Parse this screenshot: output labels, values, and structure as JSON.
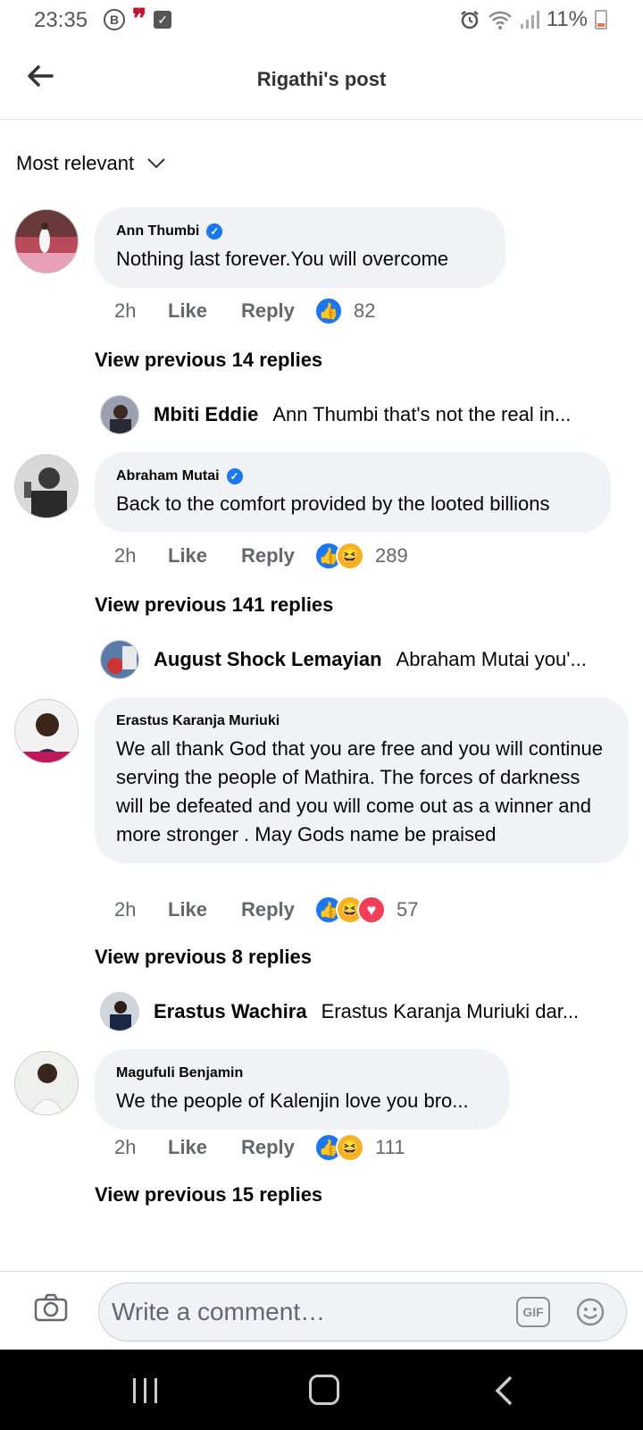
{
  "status_bar": {
    "time": "23:35",
    "battery": "11%",
    "icon_b": "B",
    "icon_quote": "❞"
  },
  "header": {
    "title": "Rigathi's post"
  },
  "sort": {
    "label": "Most relevant"
  },
  "comments": [
    {
      "author": "Ann Thumbi",
      "verified": true,
      "text": "Nothing last forever.You will overcome",
      "time": "2h",
      "like_label": "Like",
      "reply_label": "Reply",
      "reactions": [
        "like"
      ],
      "reaction_count": "82",
      "view_previous": "View previous 14 replies",
      "latest_reply": {
        "author": "Mbiti Eddie",
        "text": "Ann Thumbi that's not the real in..."
      }
    },
    {
      "author": "Abraham Mutai",
      "verified": true,
      "text": "Back to the comfort provided by the looted billions",
      "time": "2h",
      "like_label": "Like",
      "reply_label": "Reply",
      "reactions": [
        "like",
        "haha"
      ],
      "reaction_count": "289",
      "view_previous": "View previous 141 replies",
      "latest_reply": {
        "author": "August Shock Lemayian",
        "text": "Abraham Mutai you'..."
      }
    },
    {
      "author": "Erastus Karanja Muriuki",
      "verified": false,
      "text": "We all thank God that you are free and you will continue serving the people of Mathira. The forces of darkness will be defeated and you will come out as a winner and more stronger . May Gods name be praised",
      "time": "2h",
      "like_label": "Like",
      "reply_label": "Reply",
      "reactions": [
        "like",
        "haha",
        "love"
      ],
      "reaction_count": "57",
      "view_previous": "View previous 8 replies",
      "latest_reply": {
        "author": "Erastus Wachira",
        "text": "Erastus Karanja Muriuki dar..."
      }
    },
    {
      "author": "Magufuli Benjamin",
      "verified": false,
      "text": "We the people of Kalenjin love you bro...",
      "time": "2h",
      "like_label": "Like",
      "reply_label": "Reply",
      "reactions": [
        "like",
        "haha"
      ],
      "reaction_count": "111",
      "view_previous": "View previous 15 replies"
    }
  ],
  "composer": {
    "placeholder": "Write a comment…",
    "gif_label": "GIF"
  },
  "colors": {
    "accent": "#1877f2",
    "bubble": "#f0f2f5",
    "muted_text": "#65676b"
  }
}
